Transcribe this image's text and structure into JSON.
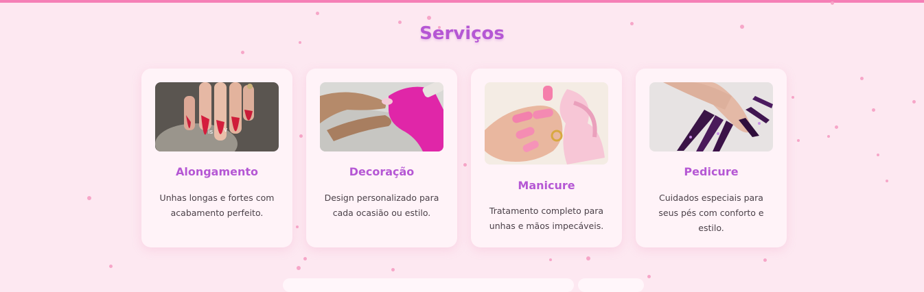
{
  "section": {
    "title": "Serviços"
  },
  "services": [
    {
      "title": "Alongamento",
      "description": "Unhas longas e fortes com acabamento perfeito.",
      "image": "red-long-nails-photo"
    },
    {
      "title": "Decoração",
      "description": "Design personalizado para cada ocasião ou estilo.",
      "image": "nail-art-application-photo"
    },
    {
      "title": "Manicure",
      "description": "Tratamento completo para unhas e mãos impecáveis.",
      "image": "pink-manicure-flowers-photo"
    },
    {
      "title": "Pedicure",
      "description": "Cuidados especiais para seus pés com conforto e estilo.",
      "image": "dark-purple-stiletto-nails-photo"
    }
  ],
  "colors": {
    "background": "#fde8f1",
    "accent": "#f57fb6",
    "title": "#b557d4",
    "card": "#fff3f8"
  }
}
